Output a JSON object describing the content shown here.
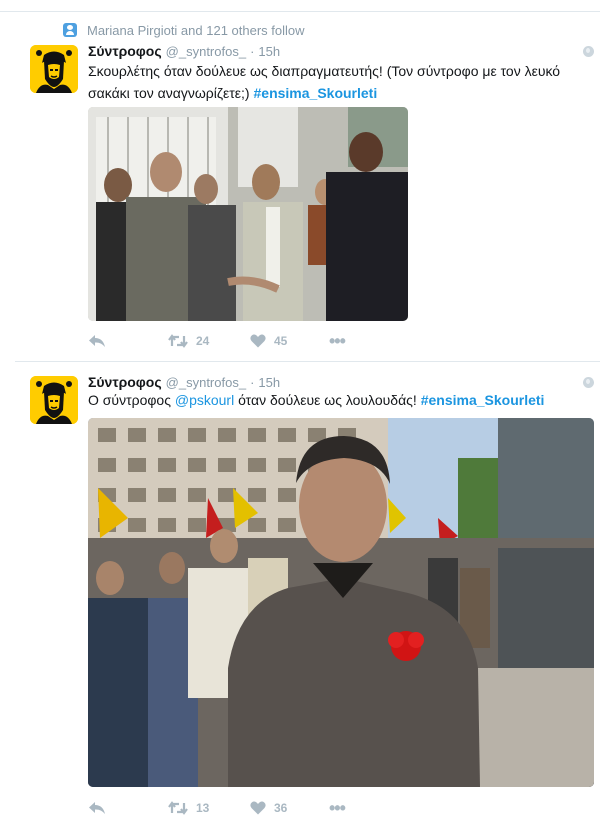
{
  "colors": {
    "link": "#1b95e0",
    "muted": "#8899a6",
    "icon": "#aab8c2",
    "avatar_bg": "#ffcc00"
  },
  "context": {
    "icon": "person-follow-icon",
    "text": "Mariana Pirgioti and 121 others follow"
  },
  "tweets": [
    {
      "name": "Σύντροφος",
      "handle": "@_syntrofos_",
      "dot": "·",
      "time": "15h",
      "text": "Σκουρλέτης όταν δούλευε ως διαπραγματευτής! (Τον σύντροφο με τον λευκό σακάκι τον αναγνωρίζετε;)",
      "hashtag": "#ensima_Skourleti",
      "media_icon": "group-photo",
      "reply_icon": "reply-icon",
      "retweets": "24",
      "likes": "45",
      "more": "•••"
    },
    {
      "name": "Σύντροφος",
      "handle": "@_syntrofos_",
      "dot": "·",
      "time": "15h",
      "text_before": "Ο σύντροφος",
      "mention": "@pskourl",
      "text_after": "όταν δούλευε ως λουλουδάς!",
      "hashtag": "#ensima_Skourleti",
      "media_icon": "street-photo",
      "reply_icon": "reply-icon",
      "retweets": "13",
      "likes": "36",
      "more": "•••"
    }
  ]
}
